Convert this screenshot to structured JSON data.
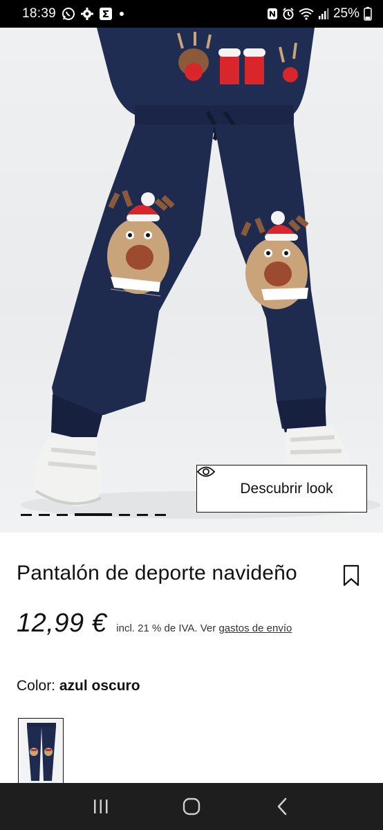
{
  "status_bar": {
    "time": "18:39",
    "left_icons": [
      "whatsapp-icon",
      "settings-icon",
      "sigma-app-icon",
      "dot-icon"
    ],
    "right_icons": [
      "nfc-icon",
      "alarm-icon",
      "wifi-icon",
      "signal-icon",
      "battery-icon"
    ],
    "battery": "25%"
  },
  "hero": {
    "look_button_label": "Descubrir look",
    "carousel": {
      "total": 7,
      "active_index": 3
    }
  },
  "product": {
    "title": "Pantalón de deporte navideño",
    "price": "12,99 €",
    "tax_prefix": "incl. 21 % de IVA. Ver ",
    "shipping_link": "gastos de envío",
    "color_label": "Color: ",
    "color_value": "azul oscuro"
  },
  "nav_bar": {
    "buttons": [
      "recent-apps-icon",
      "home-icon",
      "back-icon"
    ]
  },
  "colors": {
    "navy": "#1f2b4e",
    "accent_red": "#d9262a",
    "status_bar_bg": "#000000",
    "nav_bar_bg": "#1e1e1e"
  }
}
